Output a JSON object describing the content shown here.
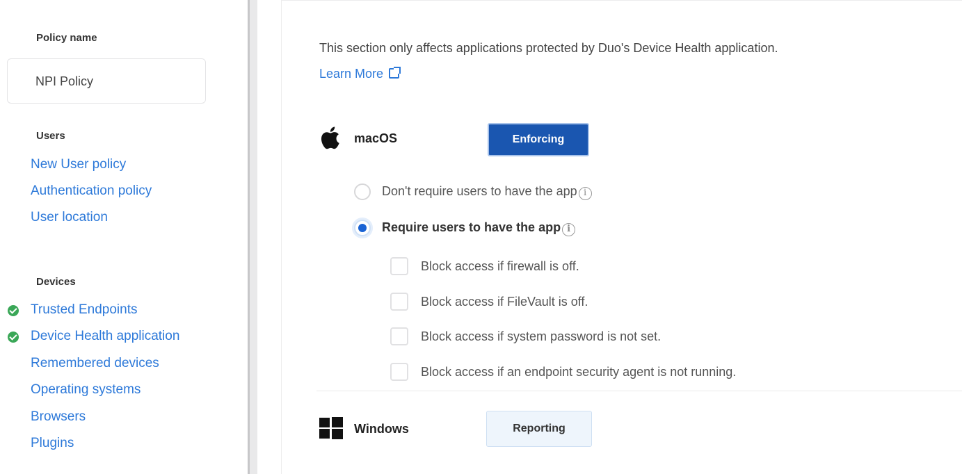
{
  "sidebar": {
    "policy_name_label": "Policy name",
    "policy_name_value": "NPI Policy",
    "users_label": "Users",
    "users_links": [
      "New User policy",
      "Authentication policy",
      "User location"
    ],
    "devices_label": "Devices",
    "devices_links": [
      {
        "label": "Trusted Endpoints",
        "status": "check"
      },
      {
        "label": "Device Health application",
        "status": "check"
      },
      {
        "label": "Remembered devices",
        "status": ""
      },
      {
        "label": "Operating systems",
        "status": ""
      },
      {
        "label": "Browsers",
        "status": ""
      },
      {
        "label": "Plugins",
        "status": ""
      }
    ]
  },
  "main": {
    "intro": "This section only affects applications protected by Duo's Device Health application.",
    "learn_more": "Learn More",
    "macos": {
      "label": "macOS",
      "button": "Enforcing",
      "icon": "apple-icon",
      "radios": [
        {
          "label": "Don't require users to have the app",
          "selected": false
        },
        {
          "label": "Require users to have the app",
          "selected": true
        }
      ],
      "checks": [
        {
          "label": "Block access if firewall is off.",
          "checked": false
        },
        {
          "label": "Block access if FileVault is off.",
          "checked": false
        },
        {
          "label": "Block access if system password is not set.",
          "checked": false
        },
        {
          "label": "Block access if an endpoint security agent is not running.",
          "checked": false
        }
      ]
    },
    "windows": {
      "label": "Windows",
      "button": "Reporting",
      "icon": "windows-icon"
    }
  },
  "colors": {
    "link": "#2d79d9",
    "primary_button": "#1a56b0",
    "check_green": "#3aa757",
    "radio_selected": "#1a63d4"
  }
}
